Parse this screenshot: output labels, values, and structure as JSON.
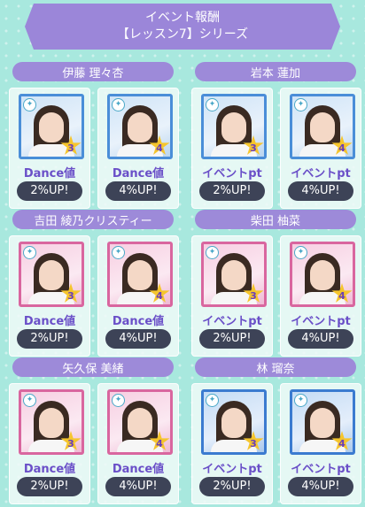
{
  "header": {
    "line1": "イベント報酬",
    "line2": "【レッスン7】シリーズ"
  },
  "groups": [
    {
      "name": "伊藤 理々杏",
      "theme": "blue",
      "cards": [
        {
          "stars": "3",
          "label": "Dance値",
          "bonus": "2%UP!"
        },
        {
          "stars": "4",
          "label": "Dance値",
          "bonus": "4%UP!"
        }
      ]
    },
    {
      "name": "岩本 蓮加",
      "theme": "blue",
      "cards": [
        {
          "stars": "3",
          "label": "イベントpt",
          "bonus": "2%UP!"
        },
        {
          "stars": "4",
          "label": "イベントpt",
          "bonus": "4%UP!"
        }
      ]
    },
    {
      "name": "吉田 綾乃クリスティー",
      "theme": "pink",
      "cards": [
        {
          "stars": "3",
          "label": "Dance値",
          "bonus": "2%UP!"
        },
        {
          "stars": "4",
          "label": "Dance値",
          "bonus": "4%UP!"
        }
      ]
    },
    {
      "name": "柴田 柚菜",
      "theme": "pink",
      "cards": [
        {
          "stars": "3",
          "label": "イベントpt",
          "bonus": "2%UP!"
        },
        {
          "stars": "4",
          "label": "イベントpt",
          "bonus": "4%UP!"
        }
      ]
    },
    {
      "name": "矢久保 美緒",
      "theme": "pink",
      "cards": [
        {
          "stars": "3",
          "label": "Dance値",
          "bonus": "2%UP!"
        },
        {
          "stars": "4",
          "label": "Dance値",
          "bonus": "4%UP!"
        }
      ]
    },
    {
      "name": "林 瑠奈",
      "theme": "blue2",
      "cards": [
        {
          "stars": "3",
          "label": "イベントpt",
          "bonus": "2%UP!"
        },
        {
          "stars": "4",
          "label": "イベントpt",
          "bonus": "4%UP!"
        }
      ]
    }
  ],
  "colors": {
    "background": "#a8e8de",
    "name_bar": "#9d8ad9",
    "label_text": "#6a4fc8",
    "pill": "#3d4357",
    "star": "#f5c52d"
  },
  "icons": {
    "attribute": "attribute-icon",
    "rarity": "star-icon"
  }
}
